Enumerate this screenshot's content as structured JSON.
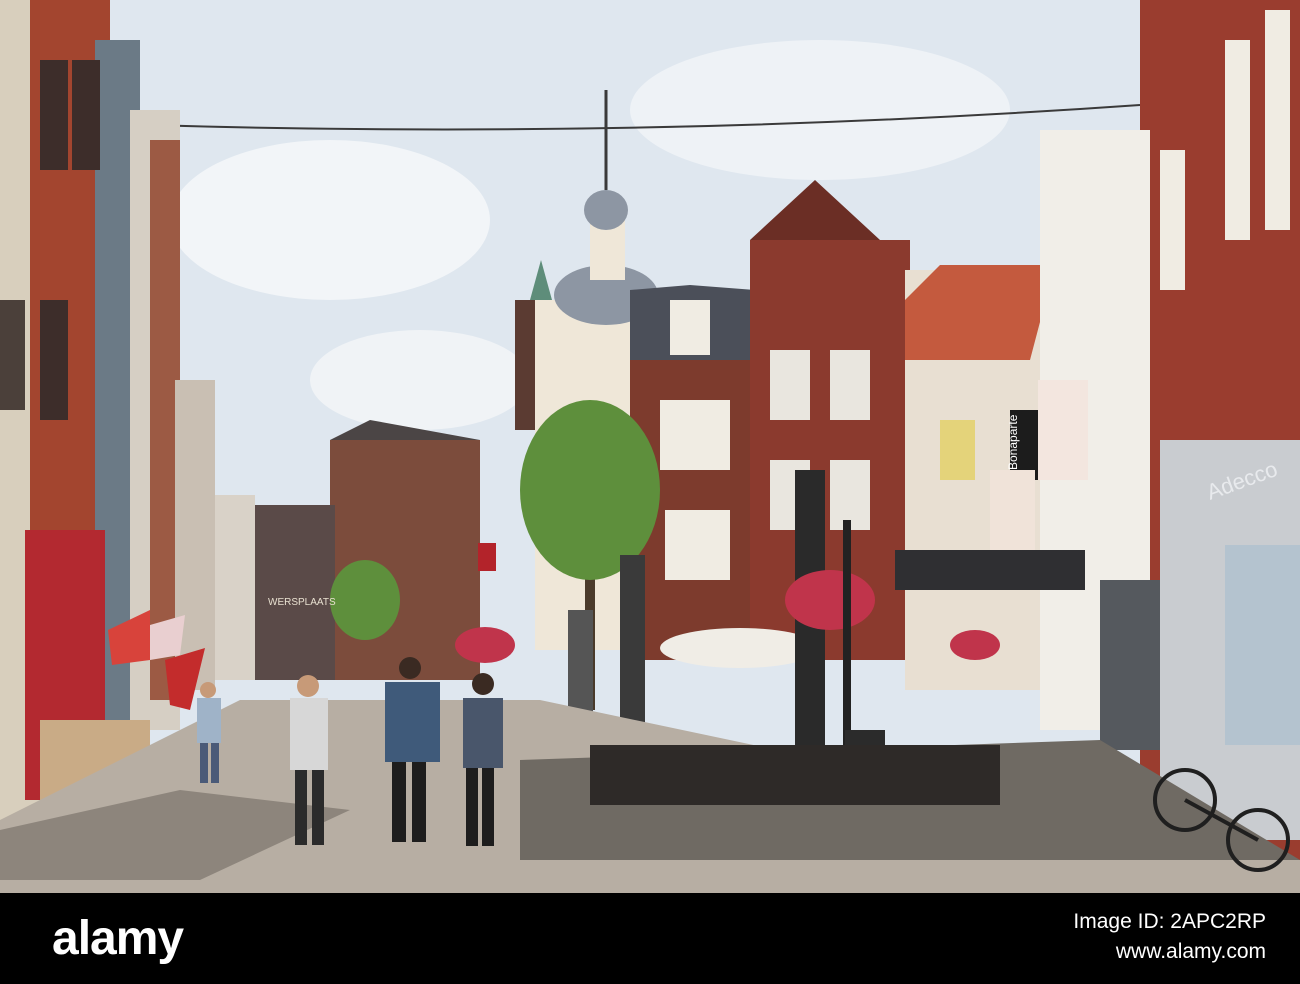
{
  "photo": {
    "subject": "street-scene",
    "signs": {
      "bonaparte": "Bonaparte",
      "adecco": "Adecco",
      "square_name": "WERSPLAATS"
    }
  },
  "footer": {
    "logo_text": "alamy",
    "image_id_label": "Image ID: 2APC2RP",
    "site_url": "www.alamy.com"
  },
  "colors": {
    "sky": "#dfe7ef",
    "brick_red": "#8b3a2e",
    "brick_dark": "#5c2a23",
    "pavement": "#b7aea3",
    "footer_bg": "#000000"
  }
}
